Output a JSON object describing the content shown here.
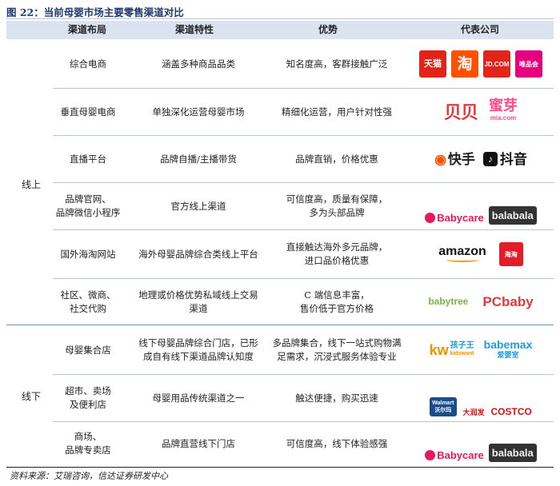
{
  "figure_title": "图 22：当前母婴市场主要零售渠道对比",
  "headers": [
    "渠道布局",
    "渠道特性",
    "优势",
    "代表公司"
  ],
  "groups": {
    "online": "线上",
    "offline": "线下"
  },
  "rows": [
    {
      "channel": "综合电商",
      "feature": "涵盖多种商品品类",
      "advantage": "知名度高，客群接触广泛",
      "logos": [
        "天猫",
        "淘",
        "JD.COM",
        "唯品会"
      ]
    },
    {
      "channel": "垂直母婴电商",
      "feature": "单独深化运营母婴市场",
      "advantage": "精细化运营，用户针对性强",
      "logos": [
        "贝贝",
        "蜜芽",
        "mia.com"
      ]
    },
    {
      "channel": "直播平台",
      "feature": "品牌自播/主播带货",
      "advantage": "品牌直销，价格优惠",
      "logos": [
        "快手",
        "抖音"
      ]
    },
    {
      "channel": "品牌官网、\n品牌微信小程序",
      "feature": "官方线上渠道",
      "advantage": "可信度高，质量有保障，\n多为头部品牌",
      "logos": [
        "Babycare",
        "balabala"
      ]
    },
    {
      "channel": "国外海淘网站",
      "feature": "海外母婴品牌综合类线上平台",
      "advantage": "直接触达海外多元品牌，\n进口品价格优惠",
      "logos": [
        "amazon",
        "海淘"
      ]
    },
    {
      "channel": "社区、微商、\n社交代购",
      "feature": "地理或价格优势私域线上交易\n渠道",
      "advantage": "C 端信息丰富，\n售价低于官方价格",
      "logos": [
        "babytree",
        "PCbaby"
      ]
    },
    {
      "channel": "母婴集合店",
      "feature": "线下母婴品牌综合门店，已形\n成自有线下渠道品牌认知度",
      "advantage": "多品牌集合，线下一站式购物满\n足需求，沉浸式服务体验专业",
      "logos": [
        "孩子王",
        "kidswant",
        "babemax",
        "爱婴室"
      ]
    },
    {
      "channel": "超市、卖场\n及便利店",
      "feature": "母婴用品传统渠道之一",
      "advantage": "触达便捷，购买迅速",
      "logos": [
        "Walmart",
        "沃尔玛",
        "大润发",
        "COSTCO"
      ]
    },
    {
      "channel": "商场、\n品牌专卖店",
      "feature": "品牌直营线下门店",
      "advantage": "可信度高，线下体验感强",
      "logos": [
        "Babycare",
        "balabala"
      ]
    }
  ],
  "source": "资料来源：艾瑞咨询，信达证券研发中心"
}
